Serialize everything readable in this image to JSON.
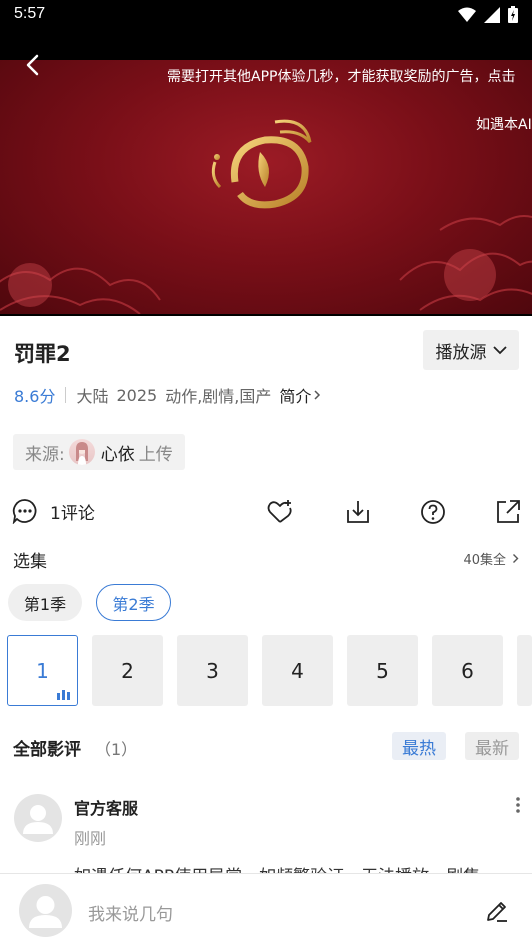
{
  "status_bar": {
    "time": "5:57"
  },
  "player": {
    "marquee_line1": "需要打开其他APP体验几秒，才能获取奖励的广告，点击",
    "marquee_line2": "如遇本AI"
  },
  "detail": {
    "title": "罚罪2",
    "source_button": "播放源",
    "score": "8.6分",
    "region": "大陆",
    "year": "2025",
    "genres": "动作,剧情,国产",
    "intro_label": "简介"
  },
  "uploader": {
    "prefix": "来源:",
    "name": "心依",
    "suffix": "上传"
  },
  "actions": {
    "comment_count": "1评论"
  },
  "episodes_section": {
    "label": "选集",
    "all_label": "40集全",
    "seasons": [
      "第1季",
      "第2季"
    ],
    "selected_season": "第2季",
    "episodes": [
      "1",
      "2",
      "3",
      "4",
      "5",
      "6"
    ],
    "selected_episode": "1"
  },
  "reviews": {
    "label": "全部影评",
    "count": "（1）",
    "sort_hot": "最热",
    "sort_new": "最新",
    "items": [
      {
        "name": "官方客服",
        "time": "刚刚",
        "body": "如遇任何APP使用异常，如频繁验证，无法播放，剧集"
      }
    ]
  },
  "composer": {
    "placeholder": "我来说几句"
  },
  "colors": {
    "accent": "#3a7bd5",
    "poster_red": "#7a0f18",
    "gold": "#d9a441"
  }
}
